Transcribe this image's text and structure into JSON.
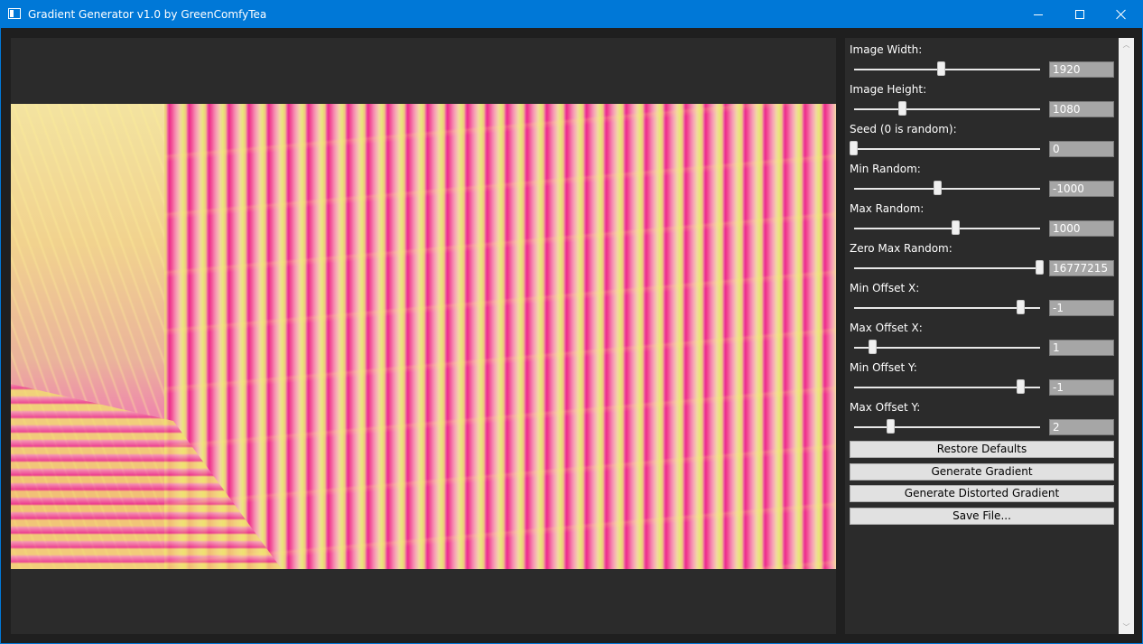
{
  "window": {
    "title": "Gradient Generator v1.0 by GreenComfyTea",
    "title_bar_color": "#0078d7"
  },
  "controls": {
    "minimize_icon": "minimize-icon",
    "maximize_icon": "maximize-icon",
    "close_icon": "close-icon"
  },
  "settings": [
    {
      "label": "Image Width:",
      "value": "1920",
      "slider_fraction": 0.47
    },
    {
      "label": "Image Height:",
      "value": "1080",
      "slider_fraction": 0.26
    },
    {
      "label": "Seed (0 is random):",
      "value": "0",
      "slider_fraction": 0.0
    },
    {
      "label": "Min Random:",
      "value": "-1000",
      "slider_fraction": 0.45
    },
    {
      "label": "Max Random:",
      "value": "1000",
      "slider_fraction": 0.55
    },
    {
      "label": "Zero Max Random:",
      "value": "16777215",
      "slider_fraction": 1.0
    },
    {
      "label": "Min Offset X:",
      "value": "-1",
      "slider_fraction": 0.9
    },
    {
      "label": "Max Offset X:",
      "value": "1",
      "slider_fraction": 0.1
    },
    {
      "label": "Min Offset Y:",
      "value": "-1",
      "slider_fraction": 0.9
    },
    {
      "label": "Max Offset Y:",
      "value": "2",
      "slider_fraction": 0.2
    }
  ],
  "buttons": {
    "restore": "Restore Defaults",
    "generate": "Generate Gradient",
    "generate_distorted": "Generate Distorted Gradient",
    "save": "Save File..."
  },
  "scrollbar": {
    "up_arrow": "chevron-up-icon",
    "down_arrow": "chevron-down-icon"
  }
}
